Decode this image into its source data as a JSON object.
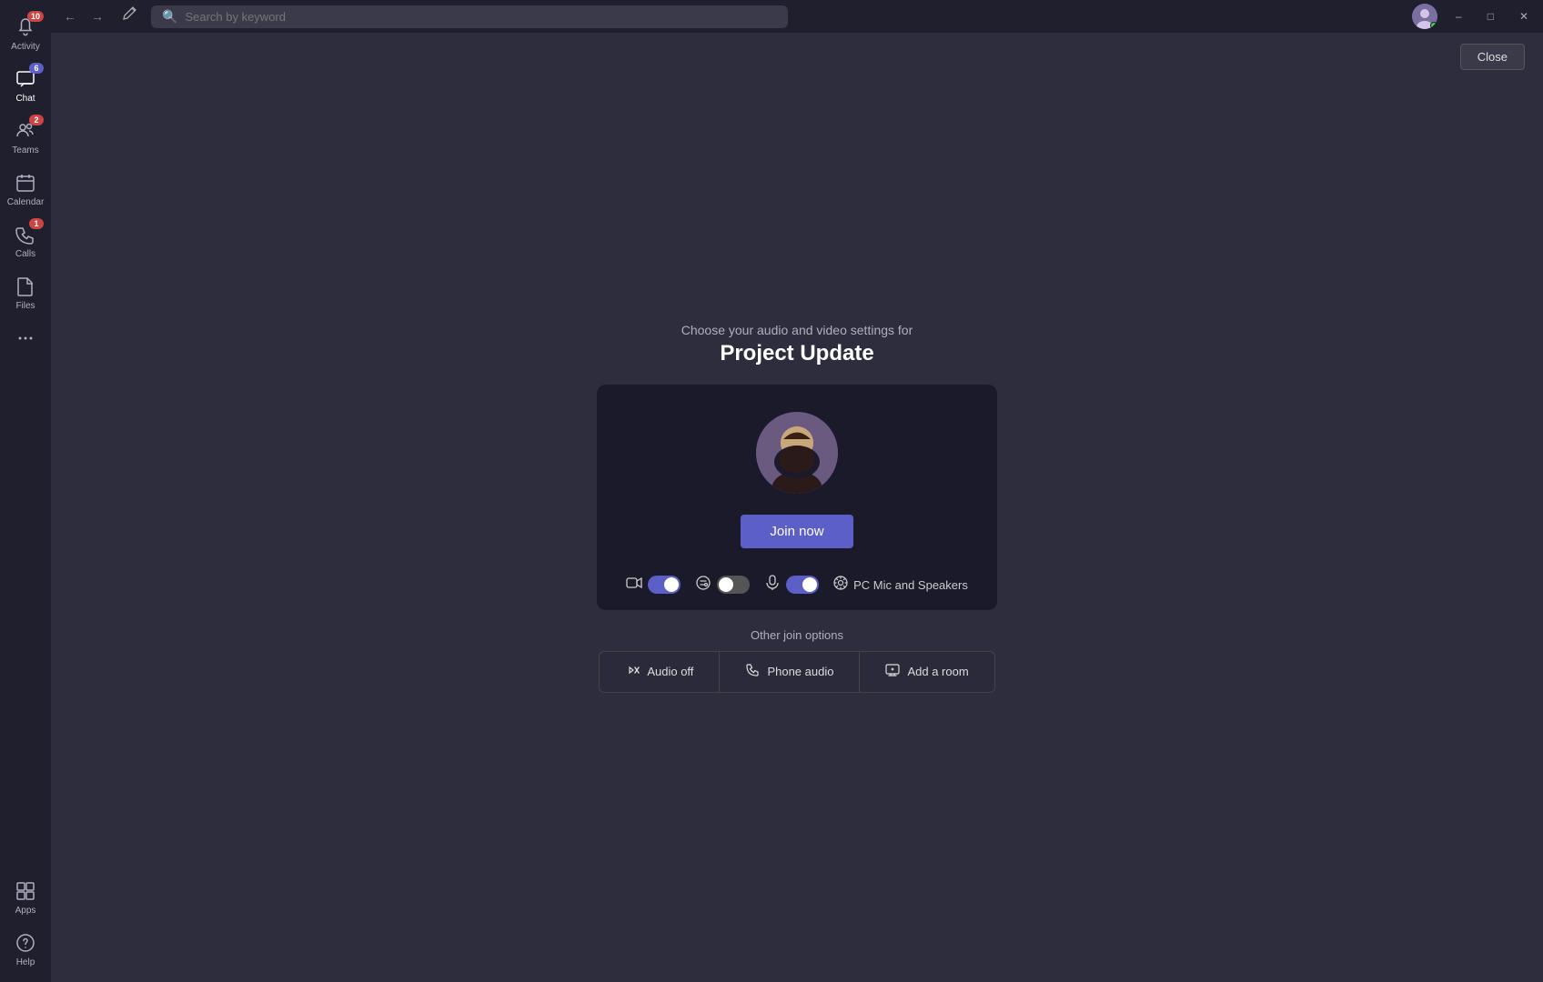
{
  "titlebar": {
    "search_placeholder": "Search by keyword",
    "back_label": "←",
    "forward_label": "→",
    "compose_label": "✎"
  },
  "window_controls": {
    "minimize": "–",
    "maximize": "□",
    "close": "✕"
  },
  "sidebar": {
    "items": [
      {
        "id": "activity",
        "label": "Activity",
        "icon": "🔔",
        "badge": "10",
        "badge_type": "red",
        "active": false
      },
      {
        "id": "chat",
        "label": "Chat",
        "icon": "💬",
        "badge": "6",
        "badge_type": "blue",
        "active": false
      },
      {
        "id": "teams",
        "label": "Teams",
        "icon": "👥",
        "badge": "2",
        "badge_type": "red",
        "active": false
      },
      {
        "id": "calendar",
        "label": "Calendar",
        "icon": "📅",
        "badge": "",
        "badge_type": "",
        "active": false
      },
      {
        "id": "calls",
        "label": "Calls",
        "icon": "📞",
        "badge": "1",
        "badge_type": "red",
        "active": false
      },
      {
        "id": "files",
        "label": "Files",
        "icon": "📁",
        "badge": "",
        "badge_type": "",
        "active": false
      },
      {
        "id": "more",
        "label": "•••",
        "icon": "•••",
        "badge": "",
        "badge_type": "",
        "active": false
      }
    ],
    "bottom_items": [
      {
        "id": "apps",
        "label": "Apps",
        "icon": "⊞",
        "badge": "",
        "badge_type": ""
      },
      {
        "id": "help",
        "label": "Help",
        "icon": "?",
        "badge": "",
        "badge_type": ""
      }
    ]
  },
  "meeting": {
    "subtitle": "Choose your audio and video settings for",
    "title": "Project Update",
    "join_now_label": "Join now",
    "close_label": "Close"
  },
  "controls": {
    "video_toggle_state": "on",
    "effects_toggle_state": "off",
    "mic_toggle_state": "on",
    "speaker_label": "PC Mic and Speakers"
  },
  "other_join": {
    "label": "Other join options",
    "options": [
      {
        "id": "audio-off",
        "icon": "🔇",
        "label": "Audio off"
      },
      {
        "id": "phone-audio",
        "icon": "📞",
        "label": "Phone audio"
      },
      {
        "id": "add-room",
        "icon": "📺",
        "label": "Add a room"
      }
    ]
  }
}
